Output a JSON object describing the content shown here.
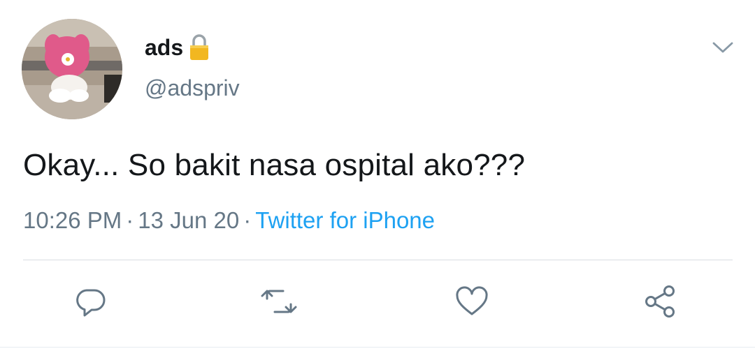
{
  "user": {
    "display_name": "ads",
    "handle": "@adspriv",
    "avatar_icon": "avatar-image",
    "protected_icon": "lock-icon"
  },
  "tweet": {
    "text": "Okay... So bakit nasa ospital ako???",
    "time": "10:26 PM",
    "date": "13 Jun 20",
    "separator": "·",
    "source": "Twitter for iPhone"
  },
  "menu": {
    "icon": "chevron-down-icon"
  },
  "actions": [
    {
      "name": "reply",
      "icon": "reply-icon"
    },
    {
      "name": "retweet",
      "icon": "retweet-icon"
    },
    {
      "name": "like",
      "icon": "heart-icon"
    },
    {
      "name": "share",
      "icon": "share-icon"
    }
  ],
  "colors": {
    "text": "#14171a",
    "secondary": "#657786",
    "link": "#1da1f2",
    "icon": "#657786",
    "lock": "#f2b720"
  }
}
